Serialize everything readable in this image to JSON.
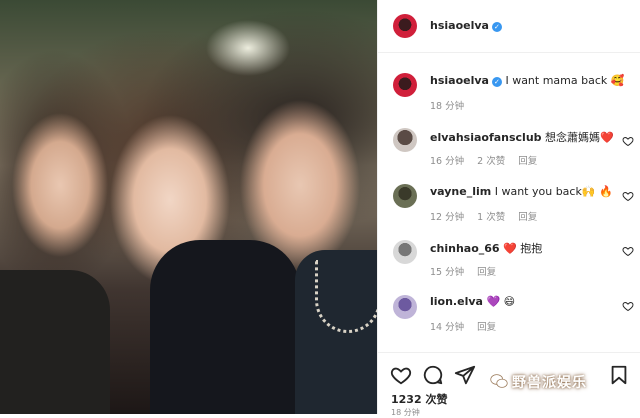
{
  "post": {
    "author": "hsiaoelva",
    "caption": "I want mama back 🥰",
    "caption_time": "18 分钟",
    "likes": "1232 次赞",
    "post_time": "18 分钟"
  },
  "comments": [
    {
      "user": "elvahsiaofansclub",
      "text": "想念蕭媽媽❤️",
      "time": "16 分钟",
      "likes": "2 次赞",
      "reply": "回复"
    },
    {
      "user": "vayne_lim",
      "text": "I want you back🙌 🔥",
      "time": "12 分钟",
      "likes": "1 次赞",
      "reply": "回复"
    },
    {
      "user": "chinhao_66",
      "text": "❤️ 抱抱",
      "time": "15 分钟",
      "likes": "",
      "reply": "回复"
    },
    {
      "user": "lion.elva",
      "text": "💜 😄",
      "time": "14 分钟",
      "likes": "",
      "reply": "回复"
    }
  ],
  "watermark": "野兽派娱乐",
  "icons": [
    "verified-badge-icon",
    "heart-icon",
    "comment-icon",
    "share-icon",
    "bookmark-icon",
    "wechat-icon"
  ],
  "colors": {
    "verified": "#3897f0",
    "meta": "#8e8e8e",
    "border": "#efefef"
  }
}
